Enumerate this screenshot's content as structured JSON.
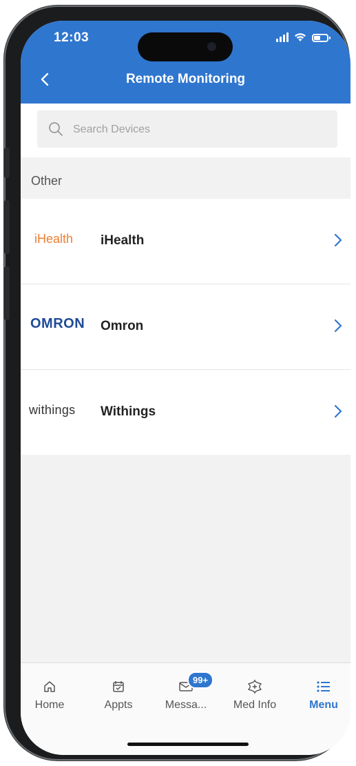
{
  "status_bar": {
    "time": "12:03"
  },
  "header": {
    "title": "Remote Monitoring"
  },
  "search": {
    "placeholder": "Search Devices"
  },
  "section": {
    "label": "Other"
  },
  "devices": [
    {
      "logo": "iHealth",
      "name": "iHealth"
    },
    {
      "logo": "OMRON",
      "name": "Omron"
    },
    {
      "logo": "withings",
      "name": "Withings"
    }
  ],
  "tabs": [
    {
      "label": "Home",
      "icon": "home-icon"
    },
    {
      "label": "Appts",
      "icon": "calendar-icon"
    },
    {
      "label": "Messa...",
      "icon": "mail-icon",
      "badge": "99+"
    },
    {
      "label": "Med Info",
      "icon": "med-info-icon"
    },
    {
      "label": "Menu",
      "icon": "menu-icon",
      "active": true
    }
  ],
  "colors": {
    "accent": "#2f76cf",
    "ihealth": "#ef7d2e",
    "omron": "#1f4a97"
  }
}
